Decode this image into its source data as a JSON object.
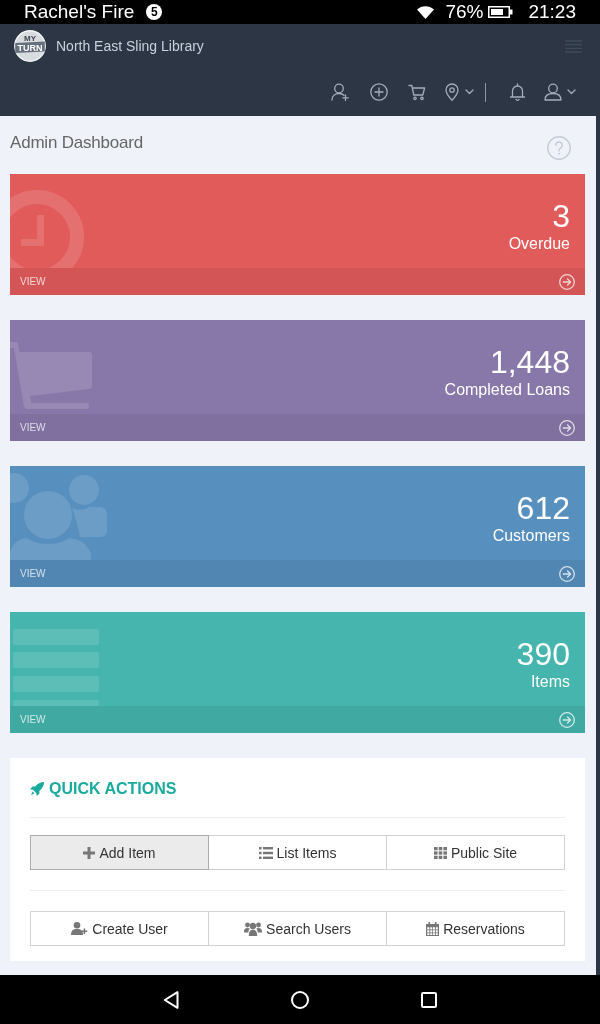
{
  "status_bar": {
    "app_title": "Rachel's Fire",
    "notification_count": "5",
    "battery": "76%",
    "time": "21:23"
  },
  "header": {
    "logo": {
      "top": "MY",
      "main": "TURN"
    },
    "brand": "North East Sling Library"
  },
  "page": {
    "title": "Admin Dashboard"
  },
  "stat_cards": [
    {
      "kind": "clock",
      "color": "#e25b5b",
      "value": "3",
      "label": "Overdue",
      "link": "VIEW"
    },
    {
      "kind": "cart",
      "color": "#8877a9",
      "value": "1,448",
      "label": "Completed Loans",
      "link": "VIEW"
    },
    {
      "kind": "users",
      "color": "#578fbe",
      "value": "612",
      "label": "Customers",
      "link": "VIEW"
    },
    {
      "kind": "list",
      "color": "#45b5ad",
      "value": "390",
      "label": "Items",
      "link": "VIEW"
    }
  ],
  "quick_actions": {
    "title": "QUICK ACTIONS",
    "rows": [
      [
        {
          "kind": "add",
          "label": "Add Item",
          "pressed": true
        },
        {
          "kind": "list",
          "label": "List Items",
          "pressed": false
        },
        {
          "kind": "grid",
          "label": "Public Site",
          "pressed": false
        }
      ],
      [
        {
          "kind": "adduser",
          "label": "Create User",
          "pressed": false
        },
        {
          "kind": "users",
          "label": "Search Users",
          "pressed": false
        },
        {
          "kind": "calendar",
          "label": "Reservations",
          "pressed": false
        }
      ]
    ]
  }
}
